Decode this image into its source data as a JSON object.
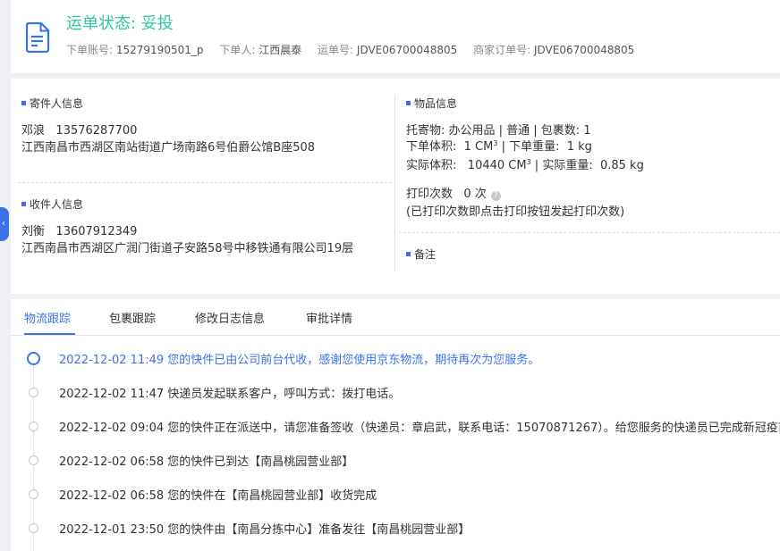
{
  "header": {
    "status_label": "运单状态: ",
    "status_value": "妥投",
    "meta": [
      {
        "label": "下单账号:",
        "value": "15279190501_p"
      },
      {
        "label": "下单人:",
        "value": "江西晨泰"
      },
      {
        "label": "运单号:",
        "value": "JDVE06700048805"
      },
      {
        "label": "商家订单号:",
        "value": "JDVE06700048805"
      }
    ],
    "icon": "document-icon",
    "accent_color": "#2ec7a1"
  },
  "sender": {
    "title": "寄件人信息",
    "name": "邓浪",
    "phone": "13576287700",
    "address": "江西南昌市西湖区南站街道广场南路6号伯爵公馆B座508"
  },
  "receiver": {
    "title": "收件人信息",
    "name": "刘衡",
    "phone": "13607912349",
    "address": "江西南昌市西湖区广润门街道子安路58号中移铁通有限公司19层"
  },
  "goods": {
    "title": "物品信息",
    "line1": "托寄物:  办公用品 | 普通 | 包裹数:  1",
    "vol_label": "下单体积:",
    "vol_value": "1 CM",
    "weight_label": " | 下单重量:",
    "weight_value": "1 kg",
    "actual_vol_label": "实际体积:",
    "actual_vol_value": "10440 CM",
    "actual_weight_label": " | 实际重量:",
    "actual_weight_value": "0.85 kg",
    "superscript": "3",
    "print_label": "打印次数",
    "print_value": "0 次",
    "help_glyph": "?",
    "print_hint": "(已打印次数即点击打印按钮发起打印次数)"
  },
  "remarks": {
    "title": "备注"
  },
  "sidebar_toggle": {
    "glyph": "‹"
  },
  "tabs": [
    {
      "label": "物流跟踪",
      "active": true
    },
    {
      "label": "包裹跟踪",
      "active": false
    },
    {
      "label": "修改日志信息",
      "active": false
    },
    {
      "label": "审批详情",
      "active": false
    }
  ],
  "timeline": [
    {
      "text": "2022-12-02 11:49 您的快件已由公司前台代收，感谢您使用京东物流，期待再次为您服务。"
    },
    {
      "text": "2022-12-02 11:47 快递员发起联系客户，呼叫方式：拨打电话。"
    },
    {
      "text": "2022-12-02 09:04 您的快件正在派送中，请您准备签收（快递员：章启武，联系电话：15070871267）。给您服务的快递员已完成新冠疫苗接种"
    },
    {
      "text": "2022-12-02 06:58 您的快件已到达【南昌桃园营业部】"
    },
    {
      "text": "2022-12-02 06:58 您的快件在【南昌桃园营业部】收货完成"
    },
    {
      "text": "2022-12-01 23:50 您的快件由【南昌分拣中心】准备发往【南昌桃园营业部】"
    }
  ],
  "colors": {
    "primary": "#3b73e6",
    "status": "#2ec7a1"
  }
}
